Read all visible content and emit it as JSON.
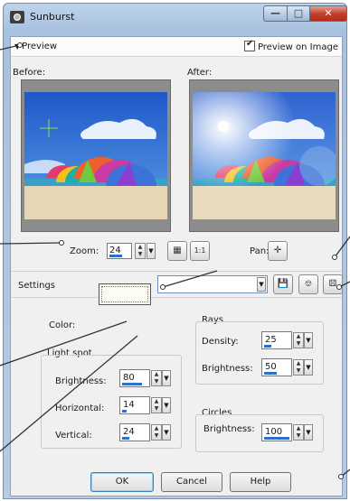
{
  "window": {
    "title": "Sunburst"
  },
  "preview": {
    "toggle_label": "Preview",
    "preview_on_image_label": "Preview on Image",
    "preview_on_image_checked": true,
    "before_label": "Before:",
    "after_label": "After:",
    "zoom_label": "Zoom:",
    "zoom_value": "24",
    "pan_label": "Pan:"
  },
  "settings": {
    "label": "Settings",
    "selected_value": ""
  },
  "color": {
    "label": "Color:",
    "value": "#fafaf0"
  },
  "light_spot": {
    "title": "Light spot",
    "brightness_label": "Brightness:",
    "brightness_value": "80",
    "horizontal_label": "Horizontal:",
    "horizontal_value": "14",
    "vertical_label": "Vertical:",
    "vertical_value": "24"
  },
  "rays": {
    "title": "Rays",
    "density_label": "Density:",
    "density_value": "25",
    "brightness_label": "Brightness:",
    "brightness_value": "50"
  },
  "circles": {
    "title": "Circles",
    "brightness_label": "Brightness:",
    "brightness_value": "100"
  },
  "buttons": {
    "ok": "OK",
    "cancel": "Cancel",
    "help": "Help"
  },
  "icons": {
    "app": "camera-icon",
    "minimize": "minimize-icon",
    "maximize": "maximize-icon",
    "close": "close-icon",
    "zoom_fit": "fit-to-window-icon",
    "zoom_actual": "actual-size-icon",
    "pan": "pan-crosshair-icon",
    "save_preset": "save-icon",
    "reset": "reset-icon",
    "randomize": "randomize-icon"
  }
}
